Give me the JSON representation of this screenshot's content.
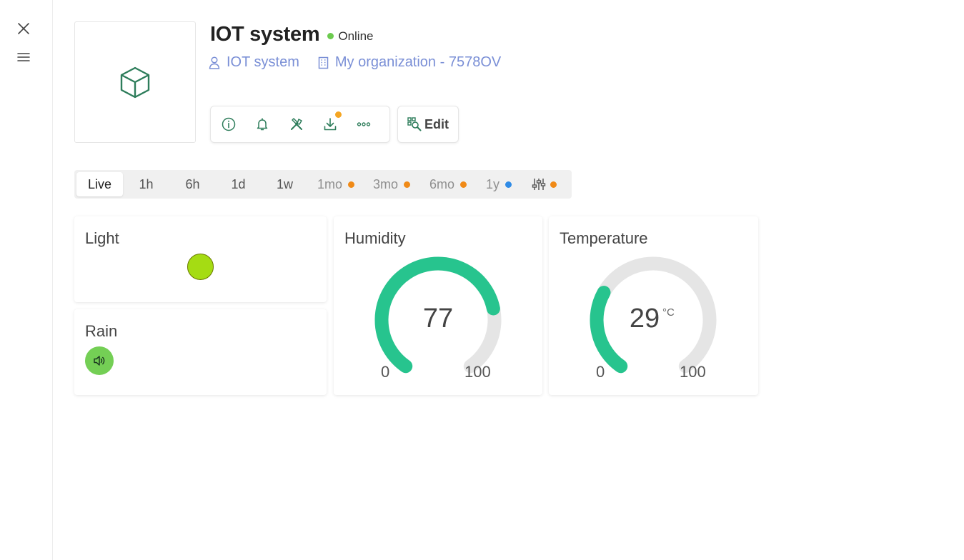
{
  "device": {
    "title": "IOT system",
    "status": "Online",
    "owner": "IOT system",
    "organization": "My organization - 7578OV"
  },
  "toolbar": {
    "edit_label": "Edit"
  },
  "colors": {
    "accent": "#2e7d5b",
    "gauge": "#27c48e",
    "gauge_track": "#e5e5e5",
    "online": "#6ccb4f",
    "link": "#7a8fd6",
    "badge_orange": "#f5a623",
    "badge_blue": "#2f8be6",
    "light_on": "#a5dc13",
    "rain_active": "#74cf55"
  },
  "time_range": {
    "tabs": [
      {
        "label": "Live",
        "active": true
      },
      {
        "label": "1h"
      },
      {
        "label": "6h"
      },
      {
        "label": "1d"
      },
      {
        "label": "1w"
      },
      {
        "label": "1mo",
        "dot": "orange"
      },
      {
        "label": "3mo",
        "dot": "orange"
      },
      {
        "label": "6mo",
        "dot": "orange"
      },
      {
        "label": "1y",
        "dot": "blue"
      }
    ],
    "settings_icon": "sliders-icon"
  },
  "widgets": {
    "light": {
      "title": "Light",
      "state": "on"
    },
    "rain": {
      "title": "Rain",
      "icon": "speaker-icon"
    },
    "humidity": {
      "title": "Humidity",
      "value": 77,
      "min": "0",
      "max": "100",
      "unit": ""
    },
    "temperature": {
      "title": "Temperature",
      "value": 29,
      "min": "0",
      "max": "100",
      "unit": "°C"
    }
  }
}
